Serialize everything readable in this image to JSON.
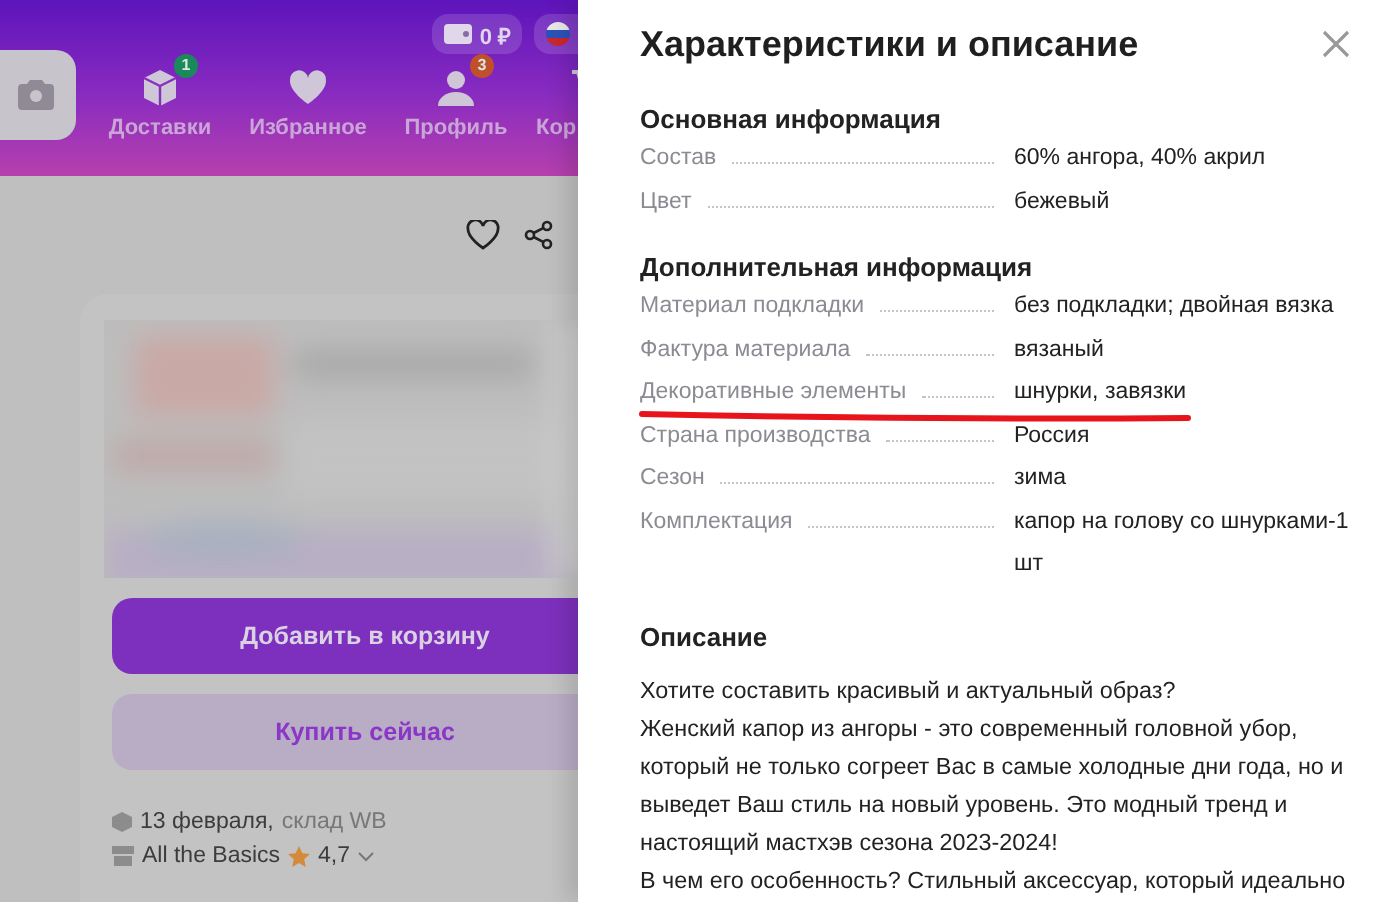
{
  "header": {
    "balance": "0 ₽",
    "nav": [
      {
        "kind": "delivery",
        "label": "Доставки",
        "badge": "1",
        "color": "#1a8a5a"
      },
      {
        "kind": "favorites",
        "label": "Избранное"
      },
      {
        "kind": "profile",
        "label": "Профиль",
        "badge": "3",
        "color": "#c0502a"
      },
      {
        "kind": "cart",
        "label": "Кор"
      }
    ]
  },
  "product": {
    "buttons": [
      {
        "kind": "primary",
        "label": "Добавить в корзину"
      },
      {
        "kind": "secondary",
        "label": "Купить сейчас"
      }
    ],
    "delivery": {
      "date": "13 февраля,",
      "warehouse": "склад WB"
    },
    "seller": {
      "name": "All the Basics",
      "rating": "4,7"
    }
  },
  "panel": {
    "title": "Характеристики и описание",
    "sections": [
      {
        "heading": "Основная информация",
        "rows": [
          {
            "label": "Состав",
            "value": "60% ангора, 40% акрил",
            "highlighted": false
          },
          {
            "label": "Цвет",
            "value": "бежевый",
            "highlighted": false
          }
        ]
      },
      {
        "heading": "Дополнительная информация",
        "rows": [
          {
            "label": "Материал подкладки",
            "value": "без подкладки; двойная вязка",
            "highlighted": false
          },
          {
            "label": "Фактура материала",
            "value": "вязаный",
            "highlighted": false
          },
          {
            "label": "Декоративные элементы",
            "value": "шнурки, завязки",
            "highlighted": true
          },
          {
            "label": "Страна производства",
            "value": "Россия",
            "highlighted": false
          },
          {
            "label": "Сезон",
            "value": "зима",
            "highlighted": false
          },
          {
            "label": "Комплектация",
            "value": "капор на голову со шнурками-1 шт",
            "highlighted": false
          }
        ]
      }
    ],
    "description": {
      "heading": "Описание",
      "paragraphs": [
        "Хотите составить красивый и актуальный образ?",
        "Женский капор из ангоры - это современный головной убор, который не только согреет Вас в самые холодные дни года, но и выведет Ваш стиль на новый уровень. Это модный тренд и настоящий мастхэв сезона 2023-2024!",
        "В чем его особенность? Стильный аксессуар, который идеально"
      ]
    }
  }
}
